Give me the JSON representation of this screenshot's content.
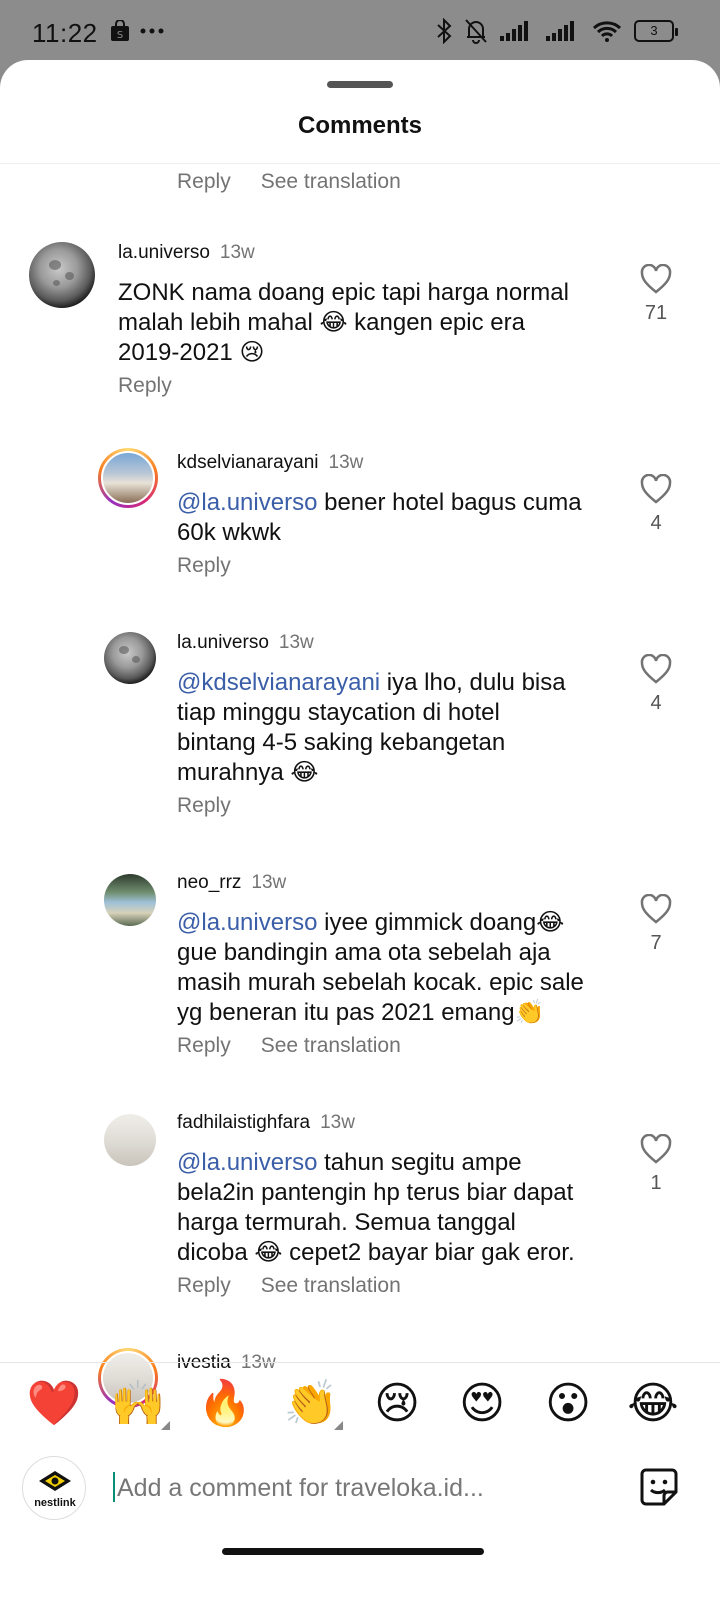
{
  "status_bar": {
    "time": "11:22",
    "battery": "3",
    "icons": [
      "shopping-bag-icon",
      "more-dots-icon",
      "bluetooth-icon",
      "mute-bell-icon",
      "signal-icon",
      "signal-icon",
      "wifi-icon",
      "battery-icon"
    ]
  },
  "sheet": {
    "title": "Comments"
  },
  "top_actions": {
    "reply": "Reply",
    "see_translation": "See translation"
  },
  "comments": [
    {
      "user": "la.universo",
      "time": "13w",
      "text_lines": [
        "ZONK nama doang epic tapi harga normal",
        "malah lebih mahal 😂 kangen epic era",
        "2019-2021 😢"
      ],
      "likes": "71",
      "reply": "Reply"
    },
    {
      "user": "kdselvianarayani",
      "time": "13w",
      "mention": "@la.universo",
      "text_lines": [
        " bener hotel bagus cuma",
        "60k wkwk"
      ],
      "likes": "4",
      "reply": "Reply"
    },
    {
      "user": "la.universo",
      "time": "13w",
      "mention": "@kdselvianarayani",
      "text_lines": [
        " iya lho, dulu bisa",
        "tiap minggu staycation di hotel",
        "bintang 4-5 saking kebangetan",
        "murahnya 😂"
      ],
      "likes": "4",
      "reply": "Reply"
    },
    {
      "user": "neo_rrz",
      "time": "13w",
      "mention": "@la.universo",
      "text_lines": [
        " iyee gimmick doang😂",
        "gue bandingin ama ota sebelah aja",
        "masih murah sebelah kocak. epic sale",
        "yg beneran itu pas 2021 emang👏"
      ],
      "likes": "7",
      "reply": "Reply",
      "see_translation": "See translation"
    },
    {
      "user": "fadhilaistighfara",
      "time": "13w",
      "mention": "@la.universo",
      "text_lines": [
        " tahun segitu ampe",
        "bela2in pantengin hp terus biar dapat",
        "harga termurah. Semua tanggal",
        "dicoba 😂 cepet2 bayar biar gak eror."
      ],
      "likes": "1",
      "reply": "Reply",
      "see_translation": "See translation"
    },
    {
      "user": "ivestia",
      "time": "13w"
    }
  ],
  "emoji_bar": [
    "❤️",
    "🙌",
    "🔥",
    "👏",
    "😢",
    "😍",
    "😮",
    "😂"
  ],
  "input": {
    "placeholder": "Add a comment for traveloka.id...",
    "avatar_text": "nestlink"
  },
  "colors": {
    "mention": "#3b5ea8",
    "muted": "#737373",
    "caret": "#0a8f74"
  }
}
